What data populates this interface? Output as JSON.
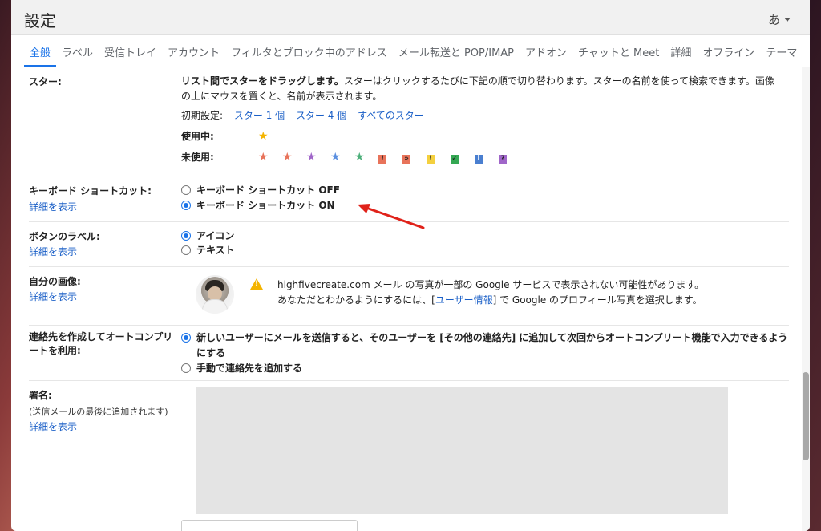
{
  "header": {
    "title": "設定",
    "ime_label": "あ"
  },
  "tabs": [
    {
      "label": "全般",
      "active": true
    },
    {
      "label": "ラベル"
    },
    {
      "label": "受信トレイ"
    },
    {
      "label": "アカウント"
    },
    {
      "label": "フィルタとブロック中のアドレス"
    },
    {
      "label": "メール転送と POP/IMAP"
    },
    {
      "label": "アドオン"
    },
    {
      "label": "チャットと Meet"
    },
    {
      "label": "詳細"
    },
    {
      "label": "オフライン"
    },
    {
      "label": "テーマ"
    }
  ],
  "stars": {
    "label": "スター:",
    "desc_bold": "リスト間でスターをドラッグします。",
    "desc_rest": "スターはクリックするたびに下記の順で切り替わります。スターの名前を使って検索できます。画像の上にマウスを置くと、名前が表示されます。",
    "presets_label": "初期設定:",
    "preset_1": "スター 1 個",
    "preset_4": "スター 4 個",
    "preset_all": "すべてのスター",
    "in_use_label": "使用中:",
    "unused_label": "未使用:",
    "in_use_color": "#f4b400",
    "unused_stars": [
      "#e8735a",
      "#e8735a",
      "#a066c9",
      "#5a8fe0",
      "#4caf7a"
    ],
    "unused_marks": [
      {
        "glyph": "!",
        "bg": "#e8735a"
      },
      {
        "glyph": "»",
        "bg": "#e8735a"
      },
      {
        "glyph": "!",
        "bg": "#f4d03f"
      },
      {
        "glyph": "✓",
        "bg": "#34a853"
      },
      {
        "glyph": "i",
        "bg": "#4a7fd0"
      },
      {
        "glyph": "?",
        "bg": "#a066c9"
      }
    ]
  },
  "shortcuts": {
    "label": "キーボード ショートカット:",
    "link": "詳細を表示",
    "option_off": "キーボード ショートカット OFF",
    "option_on": "キーボード ショートカット ON",
    "selected": "on"
  },
  "button_labels": {
    "label": "ボタンのラベル:",
    "link": "詳細を表示",
    "option_icon": "アイコン",
    "option_text": "テキスト",
    "selected": "icon"
  },
  "picture": {
    "label": "自分の画像:",
    "link": "詳細を表示",
    "line1": "highfivecreate.com メール の写真が一部の Google サービスで表示されない可能性があります。",
    "line2_pre": "あなただとわかるようにするには、[",
    "line2_link": "ユーザー情報",
    "line2_post": "] で Google のプロフィール写真を選択します。"
  },
  "autocomplete": {
    "label": "連絡先を作成してオートコンプリートを利用:",
    "option_auto": "新しいユーザーにメールを送信すると、そのユーザーを [その他の連絡先] に追加して次回からオートコンプリート機能で入力できるようにする",
    "option_manual": "手動で連絡先を追加する",
    "selected": "auto"
  },
  "signature": {
    "label": "署名:",
    "sub": "(送信メールの最後に追加されます)",
    "link": "詳細を表示"
  }
}
